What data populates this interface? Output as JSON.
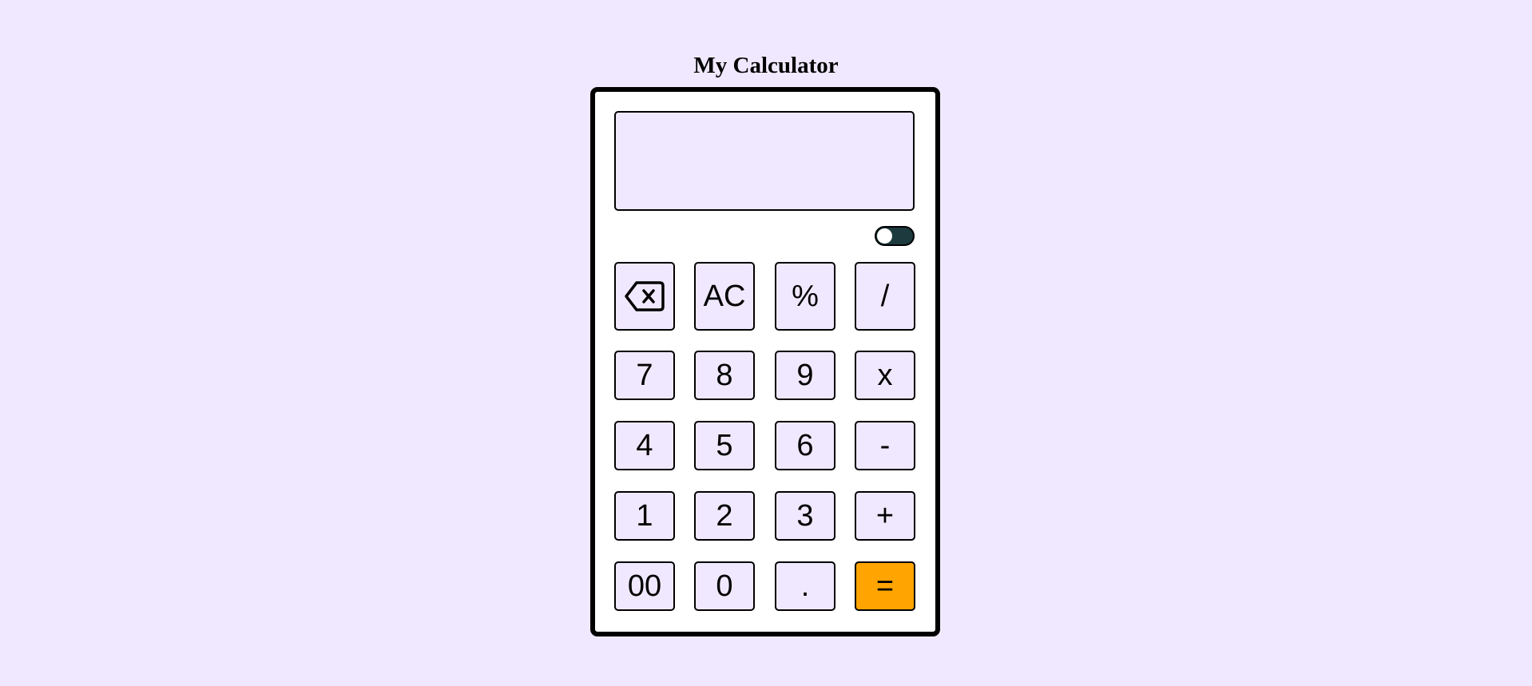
{
  "title": "My Calculator",
  "display": {
    "value": ""
  },
  "theme_toggle": {
    "state": "on"
  },
  "colors": {
    "background": "#f0e8fe",
    "calculator_body": "#ffffff",
    "button": "#f0e8fe",
    "equals_button": "#ffa400",
    "toggle_track": "#1d3b3f"
  },
  "buttons": {
    "backspace": {
      "icon": "backspace-icon"
    },
    "clear": "AC",
    "percent": "%",
    "divide": "/",
    "seven": "7",
    "eight": "8",
    "nine": "9",
    "multiply": "x",
    "four": "4",
    "five": "5",
    "six": "6",
    "subtract": "-",
    "one": "1",
    "two": "2",
    "three": "3",
    "add": "+",
    "double_zero": "00",
    "zero": "0",
    "decimal": ".",
    "equals": "="
  }
}
